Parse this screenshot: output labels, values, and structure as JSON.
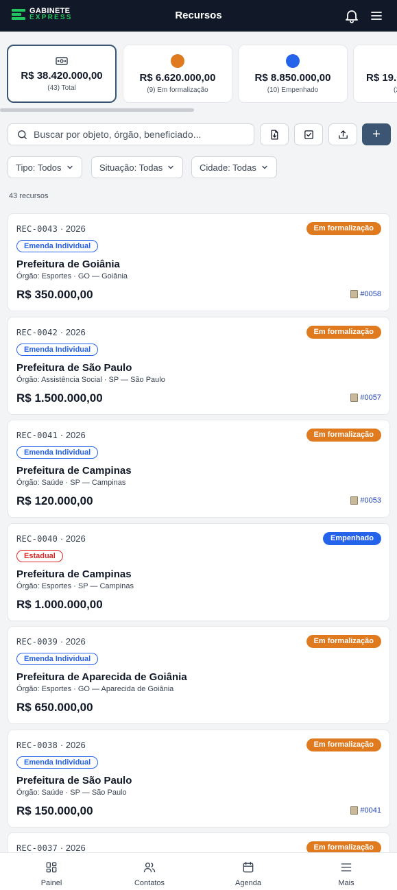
{
  "header": {
    "logo_line1": "GABINETE",
    "logo_line2": "EXPRESS",
    "title": "Recursos"
  },
  "summary": [
    {
      "icon": "money-icon",
      "amount": "R$ 38.420.000,00",
      "sub": "(43) Total",
      "active": true
    },
    {
      "icon": "dot",
      "color": "#e07a1f",
      "amount": "R$ 6.620.000,00",
      "sub": "(9) Em formalização"
    },
    {
      "icon": "dot",
      "color": "#2563eb",
      "amount": "R$ 8.850.000,00",
      "sub": "(10) Empenhado"
    },
    {
      "icon": "dot",
      "color": "#16a34a",
      "amount": "R$ 19.0",
      "sub": "(2"
    }
  ],
  "search": {
    "placeholder": "Buscar por objeto, órgão, beneficiado..."
  },
  "toolbar": {
    "add_label": "+"
  },
  "filters": [
    {
      "label": "Tipo: Todos"
    },
    {
      "label": "Situação: Todas"
    },
    {
      "label": "Cidade: Todas"
    }
  ],
  "count_text": "43 recursos",
  "colors": {
    "status_em_formalizacao": "#e07a1f",
    "status_empenhado": "#2563eb",
    "tag_emenda_individual": "#2563eb",
    "tag_estadual": "#dc2626",
    "primary": "#3b5573"
  },
  "records": [
    {
      "id": "REC-0043",
      "year": "· 2026",
      "status": "Em formalização",
      "status_color": "#e07a1f",
      "tag": "Emenda Individual",
      "tag_color": "#2563eb",
      "title": "Prefeitura de Goiânia",
      "org": "Órgão: Esportes · GO — Goiânia",
      "value": "R$ 350.000,00",
      "ref": "#0058"
    },
    {
      "id": "REC-0042",
      "year": "· 2026",
      "status": "Em formalização",
      "status_color": "#e07a1f",
      "tag": "Emenda Individual",
      "tag_color": "#2563eb",
      "title": "Prefeitura de São Paulo",
      "org": "Órgão: Assistência Social · SP — São Paulo",
      "value": "R$ 1.500.000,00",
      "ref": "#0057"
    },
    {
      "id": "REC-0041",
      "year": "· 2026",
      "status": "Em formalização",
      "status_color": "#e07a1f",
      "tag": "Emenda Individual",
      "tag_color": "#2563eb",
      "title": "Prefeitura de Campinas",
      "org": "Órgão: Saúde · SP — Campinas",
      "value": "R$ 120.000,00",
      "ref": "#0053"
    },
    {
      "id": "REC-0040",
      "year": "· 2026",
      "status": "Empenhado",
      "status_color": "#2563eb",
      "tag": "Estadual",
      "tag_color": "#dc2626",
      "title": "Prefeitura de Campinas",
      "org": "Órgão: Esportes · SP — Campinas",
      "value": "R$ 1.000.000,00",
      "ref": ""
    },
    {
      "id": "REC-0039",
      "year": "· 2026",
      "status": "Em formalização",
      "status_color": "#e07a1f",
      "tag": "Emenda Individual",
      "tag_color": "#2563eb",
      "title": "Prefeitura de Aparecida de Goiânia",
      "org": "Órgão: Esportes · GO — Aparecida de Goiânia",
      "value": "R$ 650.000,00",
      "ref": ""
    },
    {
      "id": "REC-0038",
      "year": "· 2026",
      "status": "Em formalização",
      "status_color": "#e07a1f",
      "tag": "Emenda Individual",
      "tag_color": "#2563eb",
      "title": "Prefeitura de São Paulo",
      "org": "Órgão: Saúde · SP — São Paulo",
      "value": "R$ 150.000,00",
      "ref": "#0041"
    },
    {
      "id": "REC-0037",
      "year": "· 2026",
      "status": "Em formalização",
      "status_color": "#e07a1f",
      "tag": "",
      "tag_color": "#2563eb",
      "title": "",
      "org": "",
      "value": "",
      "ref": ""
    }
  ],
  "bottom_nav": [
    {
      "label": "Painel",
      "icon": "grid-icon"
    },
    {
      "label": "Contatos",
      "icon": "users-icon"
    },
    {
      "label": "Agenda",
      "icon": "calendar-icon"
    },
    {
      "label": "Mais",
      "icon": "menu-icon"
    }
  ]
}
